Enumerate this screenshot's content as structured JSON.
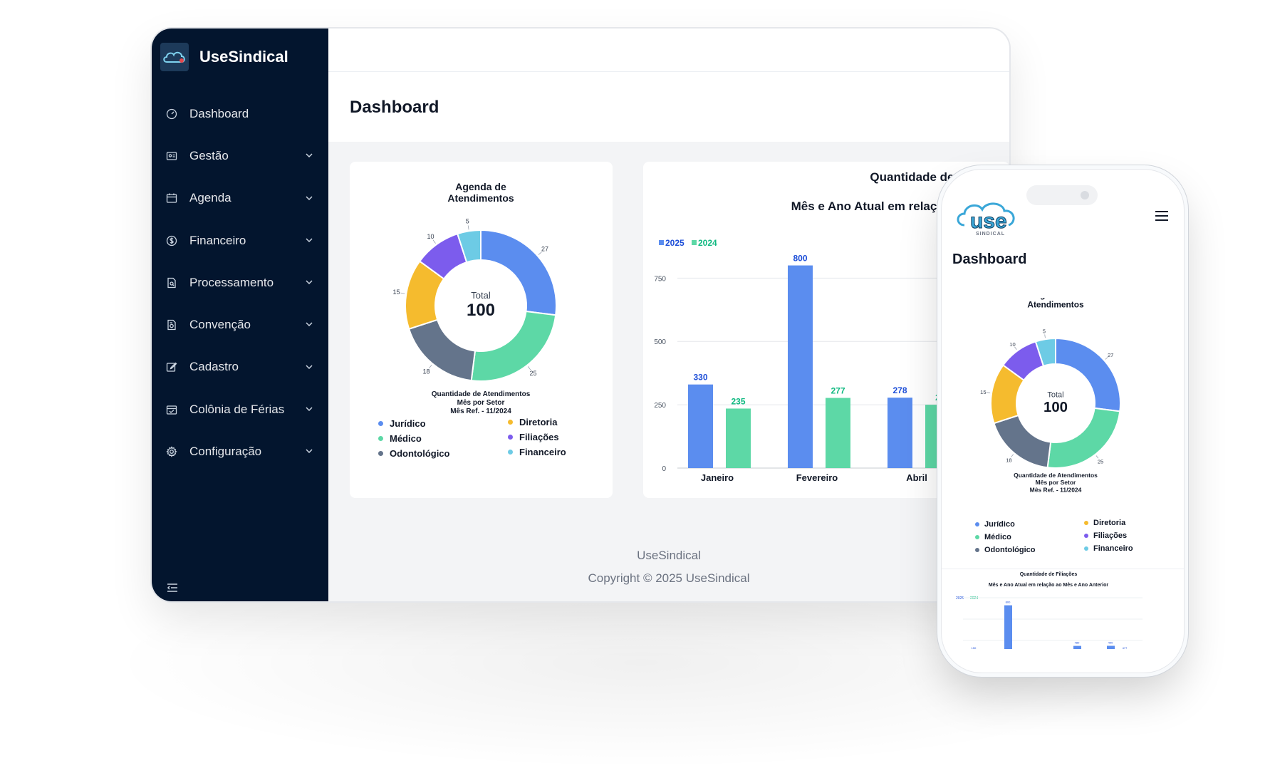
{
  "app": {
    "name": "UseSindical"
  },
  "sidebar": {
    "items": [
      {
        "label": "Dashboard",
        "icon": "dashboard-icon",
        "has_submenu": false
      },
      {
        "label": "Gestão",
        "icon": "id-card-icon",
        "has_submenu": true
      },
      {
        "label": "Agenda",
        "icon": "calendar-icon",
        "has_submenu": true
      },
      {
        "label": "Financeiro",
        "icon": "dollar-icon",
        "has_submenu": true
      },
      {
        "label": "Processamento",
        "icon": "document-search-icon",
        "has_submenu": true
      },
      {
        "label": "Convenção",
        "icon": "document-settings-icon",
        "has_submenu": true
      },
      {
        "label": "Cadastro",
        "icon": "edit-icon",
        "has_submenu": true
      },
      {
        "label": "Colônia de Férias",
        "icon": "calendar-check-icon",
        "has_submenu": true
      },
      {
        "label": "Configuração",
        "icon": "gear-icon",
        "has_submenu": true
      }
    ]
  },
  "page": {
    "title": "Dashboard"
  },
  "footer": {
    "name": "UseSindical",
    "copyright": "Copyright © 2025 UseSindical"
  },
  "colors": {
    "sidebar_bg": "#03152e",
    "juridico": "#5b8def",
    "medico": "#5dd8a6",
    "odontologico": "#64748b",
    "diretoria": "#f5bb2e",
    "filiacoes": "#7c5ced",
    "financeiro": "#6dcbe5",
    "bar_2025": "#5b8def",
    "bar_2024": "#5dd8a6"
  },
  "phone": {
    "title": "Dashboard",
    "logo_text": "use",
    "logo_sub": "SINDICAL",
    "chart2_title": "Quantidade de Filiações",
    "chart2_subtitle": "Mês e Ano Atual em relação ao Mês e Ano Anterior",
    "chart2_values": [
      {
        "label": "150",
        "value": 150
      },
      {
        "label": "800",
        "value": 800
      },
      {
        "label": "480",
        "value": 480
      },
      {
        "label": "490",
        "value": 490
      },
      {
        "label": "477",
        "value": 477
      }
    ]
  },
  "chart_data": [
    {
      "type": "pie",
      "title": "Agenda de Atendimentos",
      "center_label": "Total",
      "center_value": "100",
      "caption": [
        "Quantidade de Atendimentos",
        "Mês por Setor",
        "Mês Ref. - 11/2024"
      ],
      "slices": [
        {
          "name": "Jurídico",
          "value": 27,
          "color": "#5b8def"
        },
        {
          "name": "Médico",
          "value": 25,
          "color": "#5dd8a6"
        },
        {
          "name": "Odontológico",
          "value": 18,
          "color": "#64748b"
        },
        {
          "name": "Diretoria",
          "value": 15,
          "color": "#f5bb2e"
        },
        {
          "name": "Filiações",
          "value": 10,
          "color": "#7c5ced"
        },
        {
          "name": "Financeiro",
          "value": 5,
          "color": "#6dcbe5"
        }
      ]
    },
    {
      "type": "bar",
      "title": "Quantidade de F",
      "subtitle": "Mês e Ano Atual em relaç",
      "categories": [
        "Janeiro",
        "Fevereiro",
        "Abril"
      ],
      "series": [
        {
          "name": "2025",
          "color": "#5b8def",
          "values": [
            330,
            800,
            278
          ],
          "labels": [
            "330",
            "800",
            "278"
          ]
        },
        {
          "name": "2024",
          "color": "#5dd8a6",
          "values": [
            235,
            277,
            250
          ],
          "labels": [
            "235",
            "277",
            "2"
          ]
        }
      ],
      "yticks": [
        "0",
        "250",
        "500",
        "750"
      ],
      "ylim": [
        0,
        900
      ],
      "grid": true,
      "legend_placement": "top-left"
    }
  ]
}
